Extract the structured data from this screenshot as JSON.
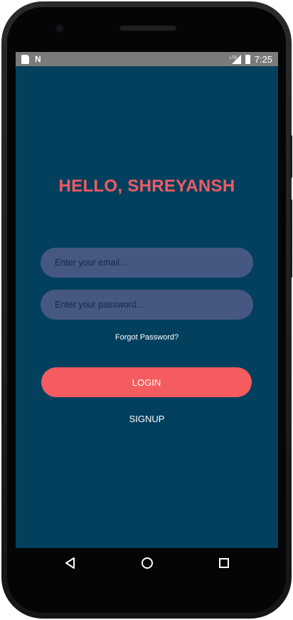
{
  "status_bar": {
    "left_icons": [
      "sd-card-icon",
      "n-icon"
    ],
    "right_icons": [
      "lte-signal-icon",
      "battery-icon"
    ],
    "time": "7:25",
    "n_glyph": "N"
  },
  "login": {
    "greeting": "HELLO, SHREYANSH",
    "email_placeholder": "Enter your email...",
    "email_value": "",
    "password_placeholder": "Enter your password...",
    "password_value": "",
    "forgot_label": "Forgot Password?",
    "login_label": "LOGIN",
    "signup_label": "SIGNUP"
  },
  "nav": {
    "icons": [
      "back-icon",
      "home-icon",
      "recents-icon"
    ]
  },
  "colors": {
    "background": "#02405e",
    "accent": "#f45c5f",
    "input": "#465881"
  }
}
